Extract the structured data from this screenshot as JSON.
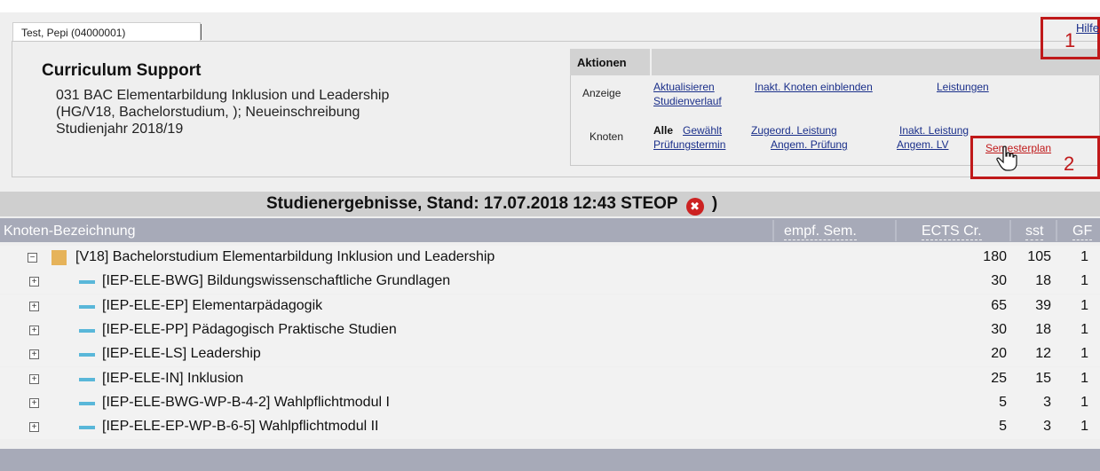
{
  "user_tab": {
    "label": "Test, Pepi (04000001)"
  },
  "header": {
    "title": "Curriculum Support",
    "study_lines": [
      "031 BAC Elementarbildung Inklusion und Leadership",
      "(HG/V18, Bachelorstudium, ); Neueinschreibung",
      "Studienjahr 2018/19"
    ]
  },
  "help_link": "Hilfe",
  "annotations": {
    "marker1": "1",
    "marker2": "2"
  },
  "actions": {
    "title": "Aktionen",
    "anzeige_label": "Anzeige",
    "anzeige_links": [
      "Aktualisieren",
      "Inakt. Knoten einblenden",
      "Leistungen",
      "Studienverlauf"
    ],
    "knoten_label": "Knoten",
    "knoten_selected": "Alle",
    "knoten_links": [
      "Gewählt",
      "Zugeord. Leistung",
      "Inakt. Leistung",
      "Prüfungstermin",
      "Angem. Prüfung",
      "Angem. LV",
      "Semesterplan"
    ]
  },
  "results": {
    "title_prefix": "Studienergebnisse, Stand: 17.07.2018 12:43 STEOP",
    "title_suffix": ")",
    "columns": {
      "name": "Knoten-Bezeichnung",
      "sem": "empf. Sem.",
      "ects": "ECTS Cr.",
      "sst": "sst",
      "gf": "GF"
    },
    "rows": [
      {
        "label": "[V18] Bachelorstudium Elementarbildung Inklusion und Leadership",
        "ects": "180",
        "sst": "105",
        "gf": "1",
        "level": 0,
        "expanded": true
      },
      {
        "label": "[IEP-ELE-BWG] Bildungswissenschaftliche Grundlagen",
        "ects": "30",
        "sst": "18",
        "gf": "1",
        "level": 1,
        "expanded": false
      },
      {
        "label": "[IEP-ELE-EP] Elementarpädagogik",
        "ects": "65",
        "sst": "39",
        "gf": "1",
        "level": 1,
        "expanded": false
      },
      {
        "label": "[IEP-ELE-PP] Pädagogisch Praktische Studien",
        "ects": "30",
        "sst": "18",
        "gf": "1",
        "level": 1,
        "expanded": false
      },
      {
        "label": "[IEP-ELE-LS] Leadership",
        "ects": "20",
        "sst": "12",
        "gf": "1",
        "level": 1,
        "expanded": false
      },
      {
        "label": "[IEP-ELE-IN] Inklusion",
        "ects": "25",
        "sst": "15",
        "gf": "1",
        "level": 1,
        "expanded": false
      },
      {
        "label": "[IEP-ELE-BWG-WP-B-4-2] Wahlpflichtmodul I",
        "ects": "5",
        "sst": "3",
        "gf": "1",
        "level": 1,
        "expanded": false
      },
      {
        "label": "[IEP-ELE-EP-WP-B-6-5] Wahlpflichtmodul II",
        "ects": "5",
        "sst": "3",
        "gf": "1",
        "level": 1,
        "expanded": false
      }
    ]
  },
  "colors": {
    "link": "#1a2f8a",
    "highlight_red": "#c0191a",
    "node_orange": "#e6b35a",
    "node_blue": "#59b7d9",
    "header_bar": "#a7aab8"
  }
}
